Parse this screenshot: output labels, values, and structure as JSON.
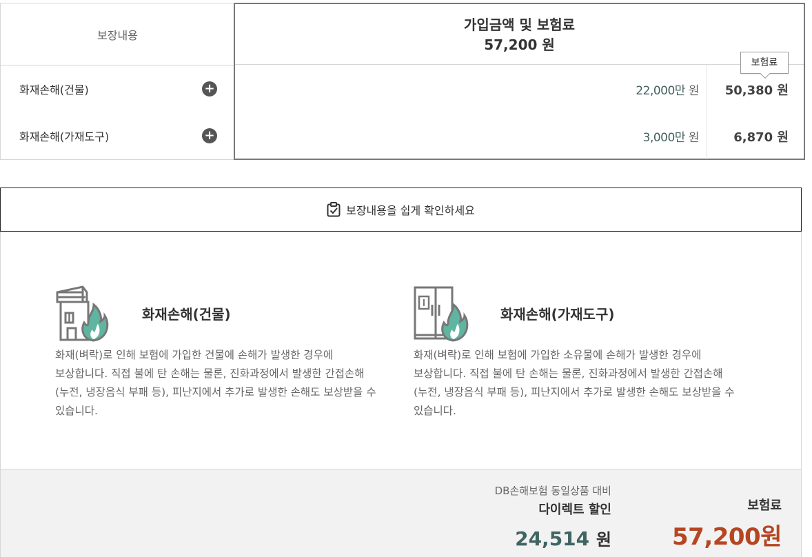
{
  "coverage_table": {
    "header_label": "보장내용",
    "amount_header_title": "가입금액 및 보험료",
    "amount_header_total": "57,200 원",
    "premium_tooltip": "보험료",
    "rows": [
      {
        "name": "화재손해(건물)",
        "amount": "22,000만",
        "amount_unit": "원",
        "premium": "50,380 원"
      },
      {
        "name": "화재손해(가재도구)",
        "amount": "3,000만",
        "amount_unit": "원",
        "premium": "6,870 원"
      }
    ]
  },
  "details": {
    "header_label": "보장내용을 쉽게 확인하세요",
    "items": [
      {
        "icon": "house-fire-icon",
        "title": "화재손해(건물)",
        "description": "화재(벼락)로 인해 보험에 가입한 건물에 손해가 발생한 경우에 보상합니다. 직접 불에 탄 손해는 물론, 진화과정에서 발생한 간접손해(누전, 냉장음식 부패 등), 피난지에서 추가로 발생한 손해도 보상받을 수 있습니다."
      },
      {
        "icon": "fridge-fire-icon",
        "title": "화재손해(가재도구)",
        "description": "화재(벼락)로 인해 보험에 가입한 소유물에 손해가 발생한 경우에 보상합니다. 직접 불에 탄 손해는 물론, 진화과정에서 발생한 간접손해(누전, 냉장음식 부패 등), 피난지에서 추가로 발생한 손해도 보상받을 수 있습니다."
      }
    ]
  },
  "summary": {
    "compare_label": "DB손해보험 동일상품 대비",
    "discount_label": "다이렉트 할인",
    "discount_value": "24,514",
    "discount_unit": "원",
    "premium_label": "보험료",
    "premium_value": "57,200원"
  },
  "colors": {
    "accent_green": "#5fb5a0",
    "price_red": "#b64621",
    "discount_teal": "#3e6561",
    "border_dark": "#76797c"
  }
}
